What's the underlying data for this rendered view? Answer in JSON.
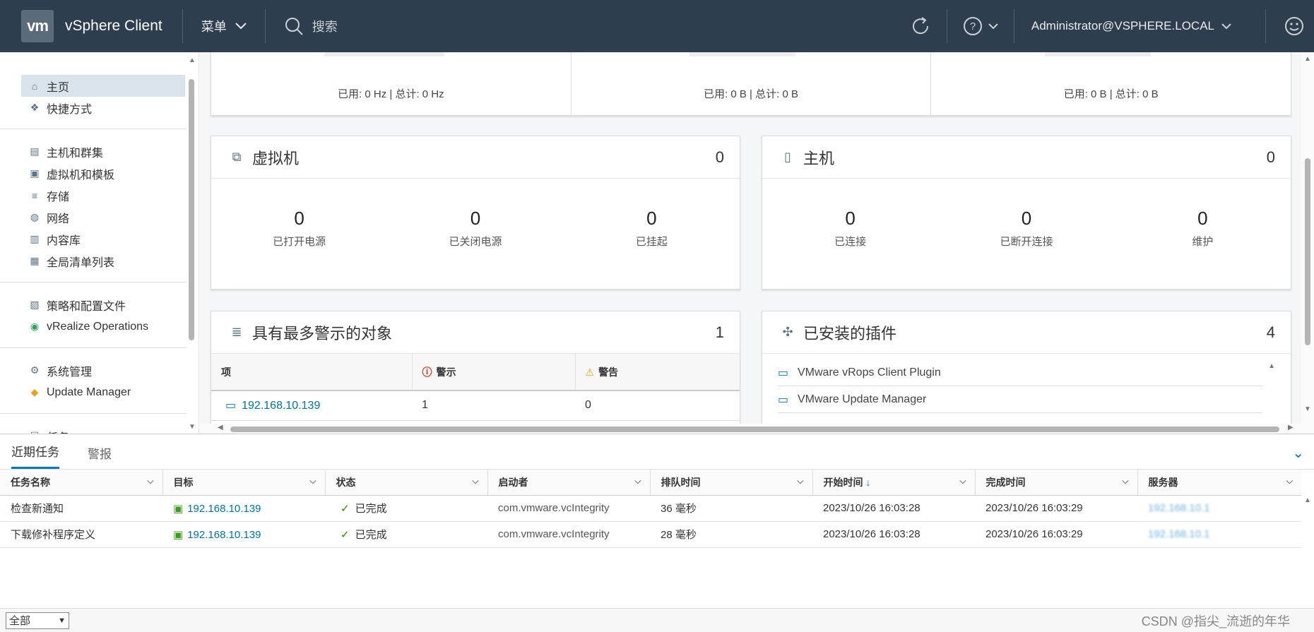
{
  "header": {
    "logo": "vm",
    "app_title": "vSphere Client",
    "menu_label": "菜单",
    "search_placeholder": "搜索",
    "user": "Administrator@VSPHERE.LOCAL"
  },
  "sidebar": {
    "groups": [
      [
        {
          "label": "主页",
          "icon": "home-icon"
        },
        {
          "label": "快捷方式",
          "icon": "shortcuts-icon"
        }
      ],
      [
        {
          "label": "主机和群集",
          "icon": "hosts-clusters-icon"
        },
        {
          "label": "虚拟机和模板",
          "icon": "vm-templates-icon"
        },
        {
          "label": "存储",
          "icon": "storage-icon"
        },
        {
          "label": "网络",
          "icon": "network-icon"
        },
        {
          "label": "内容库",
          "icon": "content-library-icon"
        },
        {
          "label": "全局清单列表",
          "icon": "global-inventory-icon"
        }
      ],
      [
        {
          "label": "策略和配置文件",
          "icon": "policies-icon"
        },
        {
          "label": "vRealize Operations",
          "icon": "vrealize-icon"
        }
      ],
      [
        {
          "label": "系统管理",
          "icon": "administration-icon"
        },
        {
          "label": "Update Manager",
          "icon": "update-manager-icon"
        }
      ],
      [
        {
          "label": "任务",
          "icon": "tasks-icon"
        }
      ]
    ]
  },
  "top_summary": [
    {
      "text": "已用: 0 Hz | 总计: 0 Hz"
    },
    {
      "text": "已用: 0 B | 总计: 0 B"
    },
    {
      "text": "已用: 0 B | 总计: 0 B"
    }
  ],
  "vm_card": {
    "title": "虚拟机",
    "count": "0",
    "stats": [
      {
        "num": "0",
        "label": "已打开电源"
      },
      {
        "num": "0",
        "label": "已关闭电源"
      },
      {
        "num": "0",
        "label": "已挂起"
      }
    ]
  },
  "host_card": {
    "title": "主机",
    "count": "0",
    "stats": [
      {
        "num": "0",
        "label": "已连接"
      },
      {
        "num": "0",
        "label": "已断开连接"
      },
      {
        "num": "0",
        "label": "维护"
      }
    ]
  },
  "alerts_card": {
    "title": "具有最多警示的对象",
    "count": "1",
    "col_item": "项",
    "col_alert": "警示",
    "col_warning": "警告",
    "rows": [
      {
        "item": "192.168.10.139",
        "alert": "1",
        "warning": "0"
      }
    ]
  },
  "plugins_card": {
    "title": "已安装的插件",
    "count": "4",
    "items": [
      "VMware vRops Client Plugin",
      "VMware Update Manager"
    ]
  },
  "tasks": {
    "tabs": [
      "近期任务",
      "警报"
    ],
    "columns": [
      "任务名称",
      "目标",
      "状态",
      "启动者",
      "排队时间",
      "开始时间",
      "完成时间",
      "服务器"
    ],
    "rows": [
      {
        "name": "检查新通知",
        "target": "192.168.10.139",
        "status": "已完成",
        "initiator": "com.vmware.vcIntegrity",
        "queued": "36 毫秒",
        "start": "2023/10/26 16:03:28",
        "end": "2023/10/26 16:03:29",
        "server": "192.168.10.1"
      },
      {
        "name": "下载修补程序定义",
        "target": "192.168.10.139",
        "status": "已完成",
        "initiator": "com.vmware.vcIntegrity",
        "queued": "28 毫秒",
        "start": "2023/10/26 16:03:28",
        "end": "2023/10/26 16:03:29",
        "server": "192.168.10.1"
      }
    ],
    "filter_value": "全部",
    "watermark": "CSDN @指尖_流逝的年华"
  }
}
